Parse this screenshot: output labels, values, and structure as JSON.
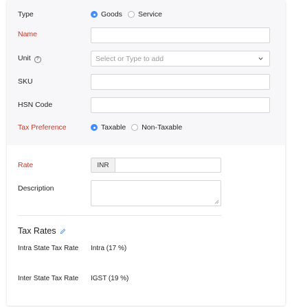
{
  "fields": {
    "type": {
      "label": "Type",
      "options": [
        {
          "label": "Goods",
          "selected": true
        },
        {
          "label": "Service",
          "selected": false
        }
      ]
    },
    "name": {
      "label": "Name",
      "value": ""
    },
    "unit": {
      "label": "Unit",
      "placeholder": "Select or Type to add",
      "help_icon": "question-icon"
    },
    "sku": {
      "label": "SKU",
      "value": ""
    },
    "hsn": {
      "label": "HSN Code",
      "value": ""
    },
    "tax_preference": {
      "label": "Tax Preference",
      "options": [
        {
          "label": "Taxable",
          "selected": true
        },
        {
          "label": "Non-Taxable",
          "selected": false
        }
      ]
    },
    "rate": {
      "label": "Rate",
      "currency": "INR",
      "value": ""
    },
    "description": {
      "label": "Description",
      "value": ""
    }
  },
  "tax_rates": {
    "title": "Tax Rates",
    "edit_icon": "pencil-icon",
    "rows": [
      {
        "label": "Intra State Tax Rate",
        "value": "Intra (17 %)"
      },
      {
        "label": "Inter State Tax Rate",
        "value": "IGST (19 %)"
      }
    ]
  },
  "colors": {
    "required_label": "#c0392b",
    "radio_accent": "#408dfb",
    "top_section_bg": "#f7f7f9",
    "border": "#d4d4d4"
  }
}
